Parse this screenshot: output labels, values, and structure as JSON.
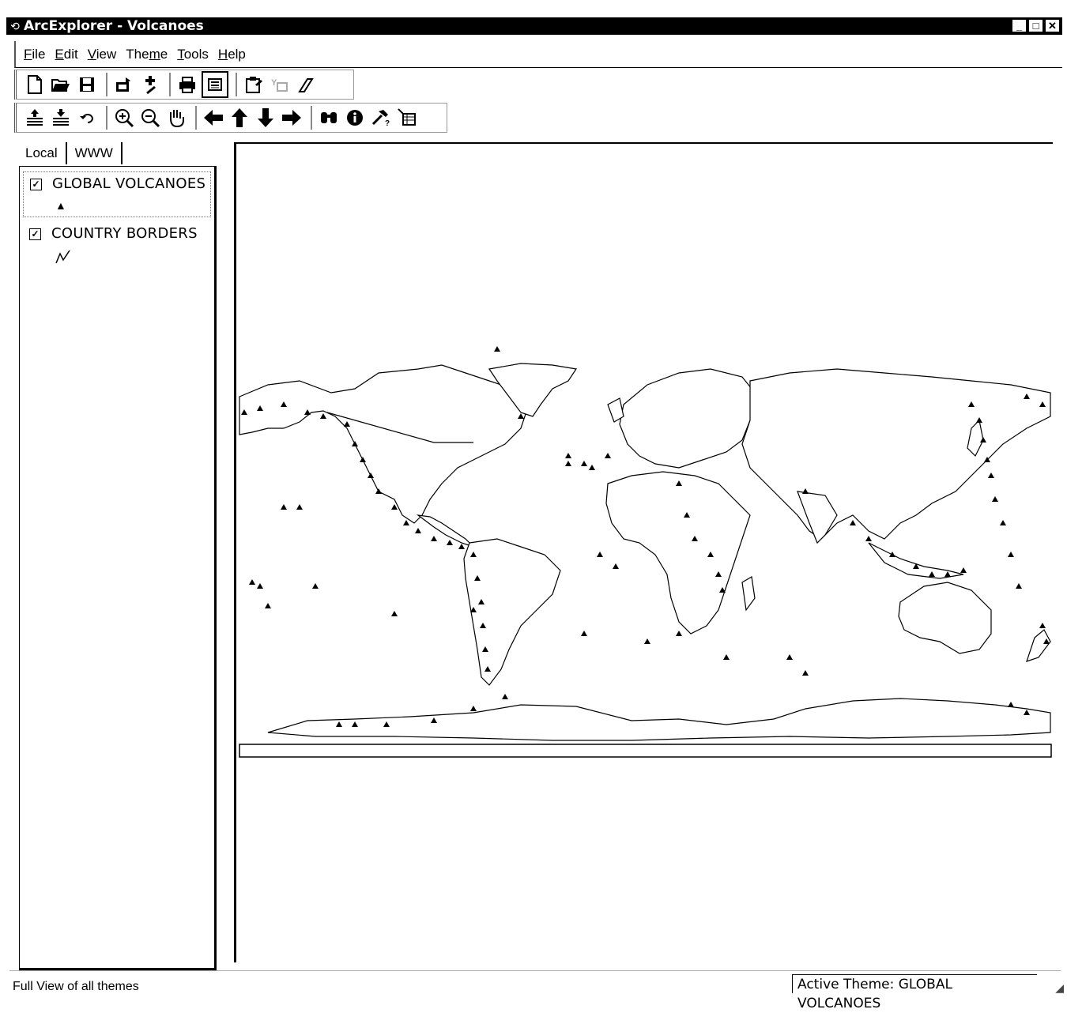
{
  "window": {
    "title": "ArcExplorer - Volcanoes",
    "icon": "arcexplorer-icon",
    "minimize": "_",
    "maximize": "□",
    "close": "✕"
  },
  "menu": [
    "File",
    "Edit",
    "View",
    "Theme",
    "Tools",
    "Help"
  ],
  "menu_underline_index": [
    0,
    0,
    0,
    3,
    0,
    0
  ],
  "toolbar1": [
    {
      "icon": "new-document-icon",
      "glyph": "🗋"
    },
    {
      "icon": "open-folder-icon",
      "glyph": "📂"
    },
    {
      "icon": "save-icon",
      "glyph": "💾"
    },
    {
      "icon": "export-icon",
      "glyph": "📤"
    },
    {
      "icon": "add-theme-icon",
      "glyph": "✚"
    },
    {
      "icon": "print-icon",
      "glyph": "🖶"
    },
    {
      "icon": "legend-toggle-icon",
      "glyph": "▤"
    },
    {
      "icon": "properties-icon",
      "glyph": "📋"
    },
    {
      "icon": "select-features-icon",
      "glyph": "⌖"
    },
    {
      "icon": "eraser-icon",
      "glyph": "⌫"
    }
  ],
  "toolbar2": [
    {
      "icon": "layers-up-icon",
      "glyph": "⇞"
    },
    {
      "icon": "layers-down-icon",
      "glyph": "⇟"
    },
    {
      "icon": "undo-icon",
      "glyph": "↶"
    },
    {
      "icon": "zoom-in-icon",
      "glyph": "⊕"
    },
    {
      "icon": "zoom-out-icon",
      "glyph": "⊖"
    },
    {
      "icon": "pan-hand-icon",
      "glyph": "✋"
    },
    {
      "icon": "arrow-left-icon",
      "glyph": "⬅"
    },
    {
      "icon": "arrow-up-icon",
      "glyph": "⬆"
    },
    {
      "icon": "arrow-down-icon",
      "glyph": "⬇"
    },
    {
      "icon": "arrow-right-icon",
      "glyph": "➡"
    },
    {
      "icon": "find-binoculars-icon",
      "glyph": "⌘"
    },
    {
      "icon": "identify-info-icon",
      "glyph": "ℹ"
    },
    {
      "icon": "hammer-tool-icon",
      "glyph": "⚒"
    },
    {
      "icon": "table-query-icon",
      "glyph": "⊞"
    }
  ],
  "tabs": [
    "Local",
    "WWW"
  ],
  "themes": [
    {
      "name": "GLOBAL VOLCANOES",
      "checked": true,
      "symbol": "▲",
      "selected": true
    },
    {
      "name": "COUNTRY BORDERS",
      "checked": true,
      "symbol": "〰",
      "selected": false
    }
  ],
  "status": {
    "left": "Full View of all themes",
    "right": "Active Theme: GLOBAL VOLCANOES"
  },
  "colors": {
    "titlebar": "#000000",
    "map_land": "#ffffff",
    "map_outline": "#000000",
    "volcano": "#000000"
  }
}
